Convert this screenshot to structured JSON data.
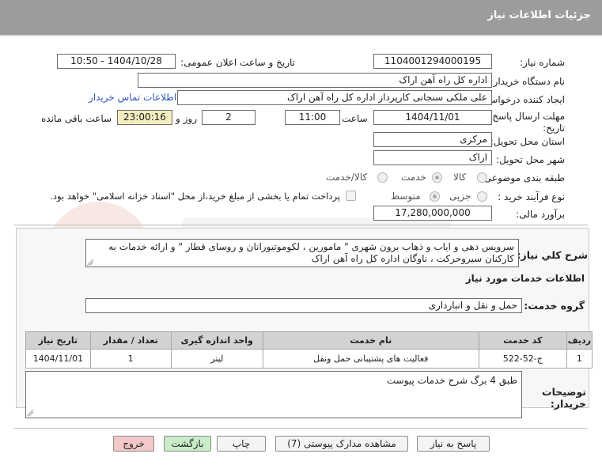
{
  "header": {
    "title": "جزئیات اطلاعات نیاز"
  },
  "form": {
    "need_number_label": "شماره نیاز:",
    "need_number": "1104001294000195",
    "announce_label": "تاریخ و ساعت اعلان عمومی:",
    "announce_value": "1404/10/28 - 10:50",
    "buyer_org_label": "نام دستگاه خریدار:",
    "buyer_org": "اداره کل راه آهن اراک",
    "creator_label": "ایجاد کننده درخواست:",
    "creator": "علی ملکی سنجانی کارپرداز اداره کل راه آهن اراک",
    "contact_link": "اطلاعات تماس خریدار",
    "deadline_label_line1": "مهلت ارسال پاسخ: تا",
    "deadline_label_line2": "تاریخ:",
    "deadline_date": "1404/11/01",
    "time_label": "ساعت",
    "deadline_time": "11:00",
    "days_value": "2",
    "days_label": "روز و",
    "remaining_time": "23:00:16",
    "remaining_label": "ساعت باقی مانده",
    "province_label": "استان محل تحویل:",
    "province": "مرکزی",
    "city_label": "شهر محل تحویل:",
    "city": "اراک",
    "category_label": "طبقه بندی موضوعی:",
    "category_options": [
      "کالا",
      "خدمت",
      "کالا/خدمت"
    ],
    "category_selected": "خدمت",
    "process_label": "نوع فرآیند خرید :",
    "process_options": [
      "جزیی",
      "متوسط"
    ],
    "process_selected": "متوسط",
    "payment_note": "پرداخت تمام یا بخشی از مبلغ خرید،از محل \"اسناد خزانه اسلامی\" خواهد بود.",
    "estimate_label": "برآورد مالی:",
    "estimate": "17,280,000,000"
  },
  "description": {
    "label": "شرح کلي نیاز:",
    "text": "سرویس دهی و ایاب و ذهاب برون شهری \" مامورین ، لکوموتیورانان و روسای قطار \" و ارائه خدمات به کارکنان سیروحرکت ، ناوگان اداره کل راه آهن اراک"
  },
  "services": {
    "section_title": "اطلاعات خدمات مورد نیاز",
    "group_label": "گروه خدمت:",
    "group_value": "حمل و نقل و انبارداری",
    "columns": [
      "ردیف",
      "کد خدمت",
      "نام خدمت",
      "واحد اندازه گیری",
      "تعداد / مقدار",
      "تاریخ نیاز"
    ],
    "rows": [
      {
        "row": "1",
        "code": "ج-52-522",
        "name": "فعالیت های پشتیبانی حمل ونقل",
        "unit": "لیتر",
        "qty": "1",
        "date": "1404/11/01"
      }
    ]
  },
  "buyer_notes": {
    "label_line1": "توضیحات",
    "label_line2": "خریدار:",
    "text": "طبق 4 برگ شرح خدمات پیوست"
  },
  "buttons": {
    "reply": "پاسخ به نیاز",
    "attachments": "مشاهده مدارک پیوستی (7)",
    "print": "چاپ",
    "back": "بازگشت",
    "exit": "خروج"
  },
  "colors": {
    "header_bg": "#9c9c9c",
    "link": "#2f56b8",
    "highlight": "#f3edc0",
    "exit_btn": "#f3c8c8",
    "back_btn": "#c9ecc9"
  }
}
